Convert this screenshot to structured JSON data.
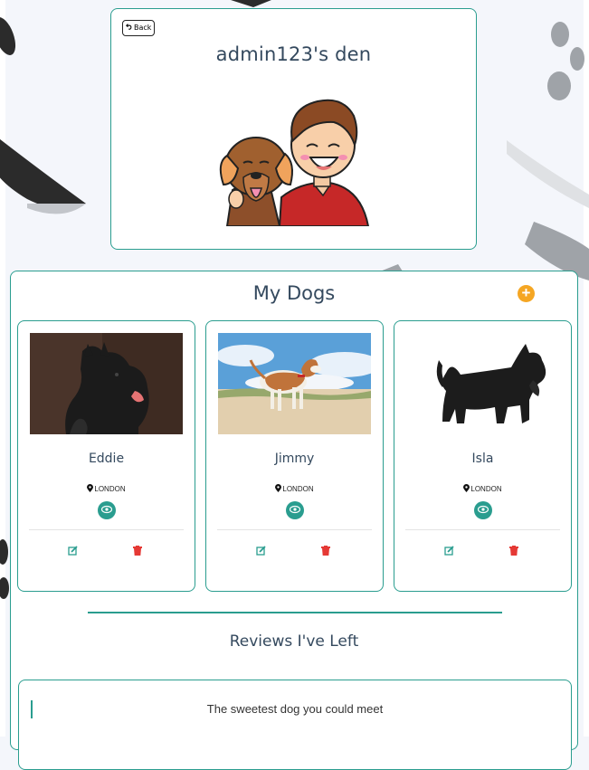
{
  "header": {
    "back_label": "Back",
    "title": "admin123's den"
  },
  "dogs_section": {
    "title": "My Dogs",
    "add_icon": "plus-circle-icon",
    "dogs": [
      {
        "name": "Eddie",
        "location": "LONDON"
      },
      {
        "name": "Jimmy",
        "location": "LONDON"
      },
      {
        "name": "Isla",
        "location": "LONDON"
      }
    ]
  },
  "reviews_section": {
    "title": "Reviews I've Left",
    "reviews": [
      {
        "text": "The sweetest dog you could meet"
      }
    ]
  },
  "colors": {
    "accent": "#2a9d8f",
    "add": "#f5a623",
    "delete": "#e53935",
    "heading": "#34495e",
    "page_bg": "#f4f6fb"
  }
}
